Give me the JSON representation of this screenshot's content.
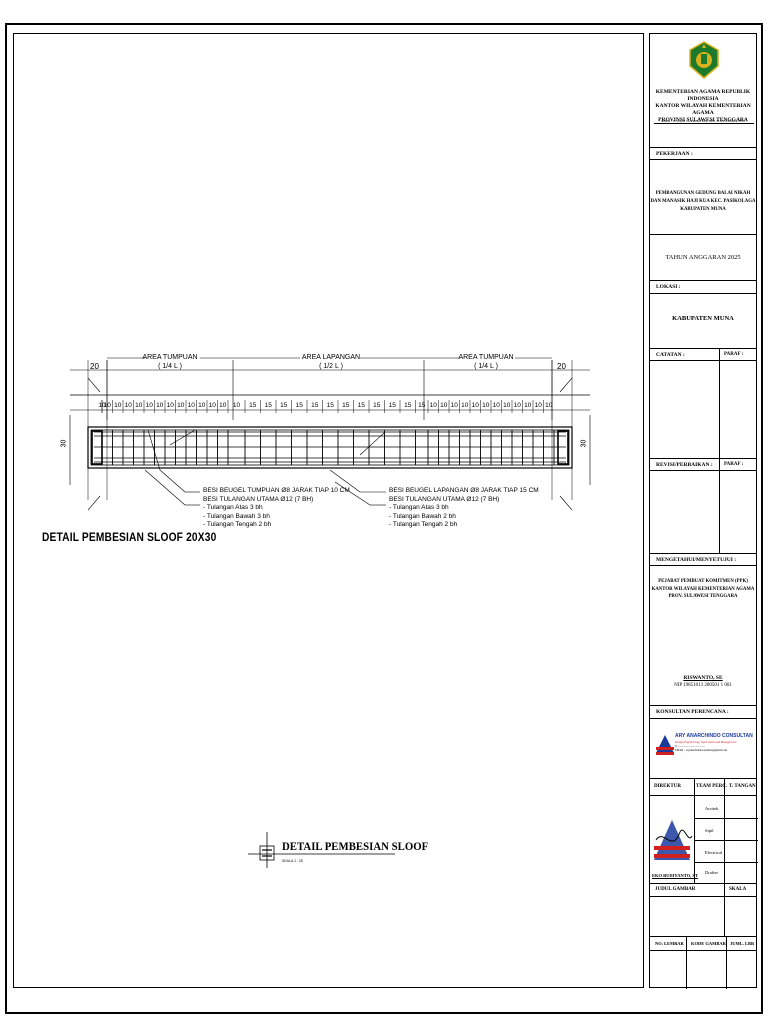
{
  "drawing": {
    "main_title": "DETAIL PEMBESIAN SLOOF 20X30",
    "dimensions": {
      "left_end": "20",
      "right_end": "20",
      "depth_left": "30",
      "depth_right": "30",
      "zones": [
        {
          "name": "AREA TUMPUAN",
          "fraction": "( 1/4 L )"
        },
        {
          "name": "AREA LAPANGAN",
          "fraction": "( 1/2 L )"
        },
        {
          "name": "AREA TUMPUAN",
          "fraction": "( 1/4 L )"
        }
      ],
      "stirrup_spacing_support": "10",
      "stirrup_spacing_field": "15"
    },
    "notes_left": {
      "line1": "BESI BEUGEL TUMPUAN Ø8 JARAK TIAP 10 CM",
      "line2": "BESI TULANGAN UTAMA Ø12 (7 BH)",
      "line3": "- Tulangan Atas 3 bh",
      "line4": "- Tulangan Bawah 3 bh",
      "line5": "- Tulangan Tengah 2 bh"
    },
    "notes_right": {
      "line1": "BESI BEUGEL LAPANGAN Ø8 JARAK TIAP 15 CM",
      "line2": "BESI TULANGAN UTAMA Ø12 (7 BH)",
      "line3": "- Tulangan Atas 3 bh",
      "line4": "- Tulangan Bawah 2 bh",
      "line5": "- Tulangan Tengah 2 bh"
    },
    "reference_title": "DETAIL PEMBESIAN SLOOF",
    "reference_scale": "SKALA 1 : 25"
  },
  "title_block": {
    "org": {
      "line1": "KEMENTERIAN AGAMA REPUBLIK INDONESIA",
      "line2": "KANTOR WILAYAH KEMENTERIAN AGAMA",
      "line3": "PROVINSI SULAWESI TENGGARA",
      "address": "Alamat : Jl. Istiqlal 1A Kendari Telp. 0401-3122350 Kendari 93117"
    },
    "pekerjaan_label": "PEKERJAAN :",
    "project": {
      "line1": "PEMBANGUNAN GEDUNG BALAI NIKAH",
      "line2": "DAN MANASIK HAJI KUA KEC. PASIKOLAGA",
      "line3": "KABUPATEN MUNA"
    },
    "year": "TAHUN ANGGARAN 2025",
    "lokasi_label": "LOKASI :",
    "lokasi_value": "KABUPATEN MUNA",
    "catatan_label": "CATATAN :",
    "paraf_label": "PARAF :",
    "revisi_label": "REVISI/PERBAIKAN :",
    "paraf2_label": "PARAF :",
    "mengetahui_label": "MENGETAHUI/MENYETUJUI :",
    "ppk": {
      "line1": "PEJABAT PEMBUAT KOMITMEN (PPK)",
      "line2": "KANTOR WILAYAH KEMENTERIAN AGAMA",
      "line3": "PROV. SULAWESI TENGGARA",
      "name": "RISWANTO, SE",
      "nip": "NIP 19851013 200501 1 001"
    },
    "konsultan_label": "KONSULTAN PERENCANA :",
    "konsultan_name": "ARY ANARCHINDO CONSULTAN",
    "konsultan_tagline": "Design Engineering, Supervision and Management",
    "konsultan_contact": "Jl. ......................................",
    "konsultan_email": "EMAIL : aryanarchindoconsultan@gmail.com",
    "direktur_label": "DIREKTUR",
    "team_label": "TEAM PERC.",
    "ttangan_label": "T. TANGAN",
    "team_roles": [
      "Arsitek",
      "Sipil",
      "Electrical",
      "Drafter"
    ],
    "direktur_name": "EKO BUDIYANTO, ST",
    "judul_label": "JUDUL GAMBAR",
    "skala_label": "SKALA",
    "no_lembar_label": "NO. LEMBAR",
    "kode_label": "KODE GAMBAR",
    "jumlah_label": "JUML. LBR"
  },
  "colors": {
    "line": "#000000",
    "consultant_blue": "#1a3a9c",
    "consultant_red": "#d02020",
    "logo_green": "#1d7a2b",
    "logo_gold": "#d8b21a"
  }
}
